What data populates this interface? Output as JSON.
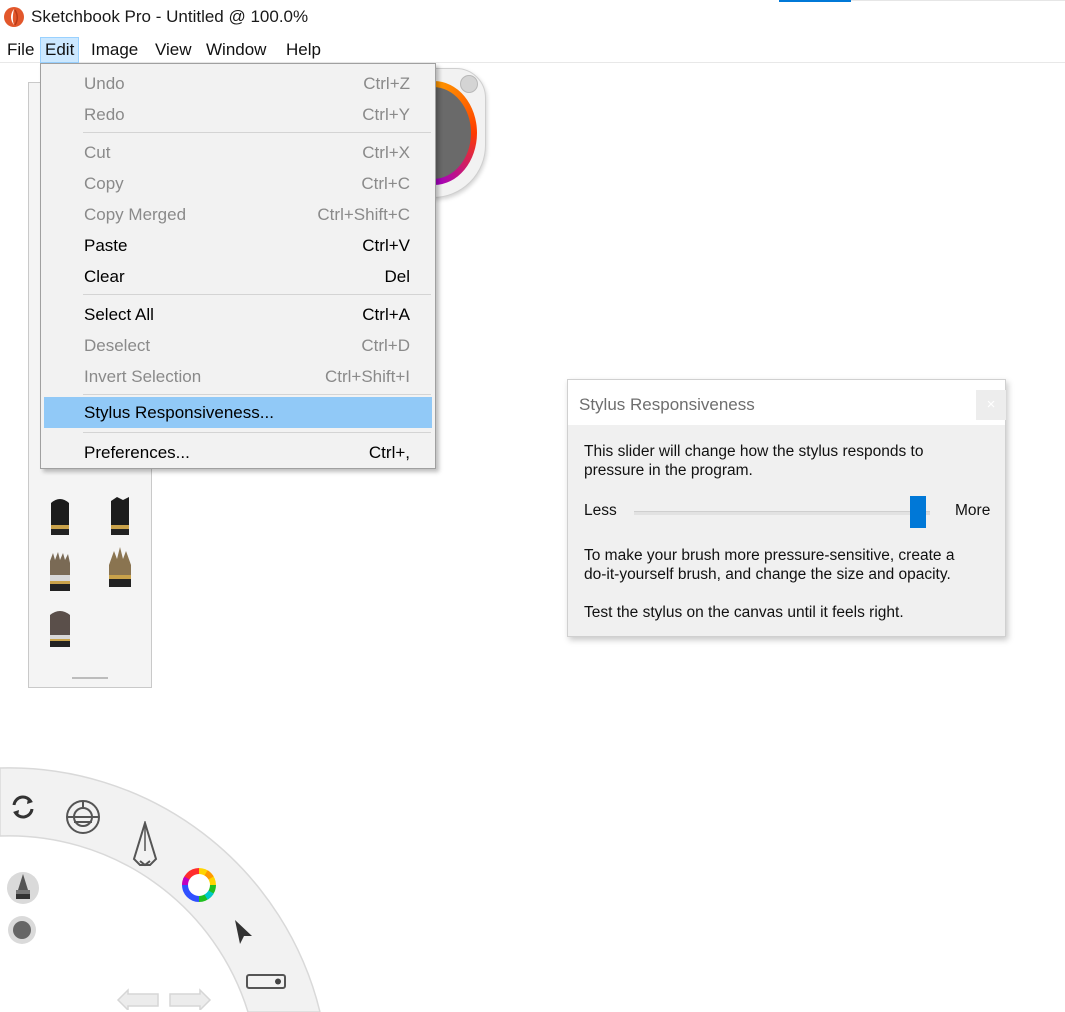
{
  "window": {
    "title": "Sketchbook Pro - Untitled @ 100.0%"
  },
  "menubar": {
    "items": [
      {
        "label": "File"
      },
      {
        "label": "Edit"
      },
      {
        "label": "Image"
      },
      {
        "label": "View"
      },
      {
        "label": "Window"
      },
      {
        "label": "Help"
      }
    ],
    "active": "Edit"
  },
  "edit_menu": {
    "items": [
      {
        "label": "Undo",
        "shortcut": "Ctrl+Z",
        "enabled": false
      },
      {
        "label": "Redo",
        "shortcut": "Ctrl+Y",
        "enabled": false
      },
      {
        "label": "Cut",
        "shortcut": "Ctrl+X",
        "enabled": false
      },
      {
        "label": "Copy",
        "shortcut": "Ctrl+C",
        "enabled": false
      },
      {
        "label": "Copy Merged",
        "shortcut": "Ctrl+Shift+C",
        "enabled": false
      },
      {
        "label": "Paste",
        "shortcut": "Ctrl+V",
        "enabled": true
      },
      {
        "label": "Clear",
        "shortcut": "Del",
        "enabled": true
      },
      {
        "label": "Select All",
        "shortcut": "Ctrl+A",
        "enabled": true
      },
      {
        "label": "Deselect",
        "shortcut": "Ctrl+D",
        "enabled": false
      },
      {
        "label": "Invert Selection",
        "shortcut": "Ctrl+Shift+I",
        "enabled": false
      },
      {
        "label": "Stylus Responsiveness...",
        "shortcut": "",
        "enabled": true,
        "highlighted": true
      },
      {
        "label": "Preferences...",
        "shortcut": "Ctrl+,",
        "enabled": true
      }
    ]
  },
  "stylus_dialog": {
    "title": "Stylus Responsiveness",
    "close_label": "×",
    "description_line1": "This slider will change how the stylus responds to",
    "description_line2": "pressure in the program.",
    "slider_min_label": "Less",
    "slider_max_label": "More",
    "slider_value": 0.96,
    "hint_line1": "To make your brush more pressure-sensitive, create a",
    "hint_line2": "do-it-yourself brush, and change the size and opacity.",
    "tip": "Test the stylus on the canvas until it feels right."
  },
  "colors": {
    "accent": "#0078d7",
    "menu_highlight": "#91c9f7",
    "menu_active_bg": "#cce8ff",
    "disabled_text": "#8a8a8a"
  },
  "icons": {
    "app": "sketchbook-app-icon",
    "toolbar": [
      "sync-icon",
      "symmetry-icon",
      "pencil-icon",
      "color-wheel-icon",
      "select-arrow-icon",
      "brush-stylus-icon",
      "color-dot-icon",
      "undo-icon",
      "redo-icon",
      "toggle-icon"
    ]
  }
}
